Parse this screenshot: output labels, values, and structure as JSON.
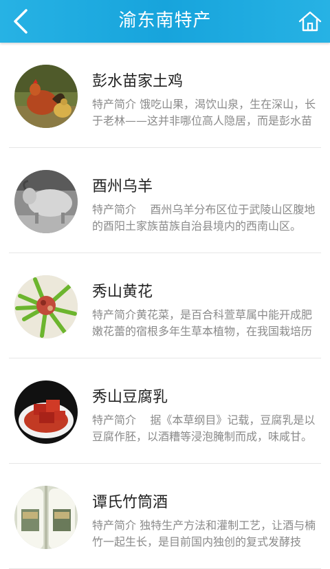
{
  "header": {
    "title": "渝东南特产",
    "back_icon": "chevron-left-icon",
    "home_icon": "home-icon"
  },
  "colors": {
    "header_bg": "#1aa7de",
    "title_text": "#222222",
    "desc_text": "#8a8a8a",
    "divider": "#e6e6e6"
  },
  "items": [
    {
      "title": "彭水苗家土鸡",
      "label": "特产简介",
      "desc": " 饿吃山果，渴饮山泉，生在深山，长于老林——这并非哪位高人隐居，而是彭水苗家土鸡的生长环境。",
      "image": "chicken-photo"
    },
    {
      "title": "酉州乌羊",
      "label": "特产简介",
      "desc": "    酉州乌羊分布区位于武陵山区腹地的酉阳土家族苗族自治县境内的西南山区。",
      "image": "goat-photo"
    },
    {
      "title": "秀山黄花",
      "label": "特产简介",
      "desc": "黄花菜，是百合科萱草属中能开成肥嫩花蕾的宿根多年生草本植物，在我国栽培历史悠久。",
      "image": "daylily-dish-photo"
    },
    {
      "title": "秀山豆腐乳",
      "label": "特产简介",
      "desc": "    据《本草纲目》记载，豆腐乳是以豆腐作胚，以酒糟等浸泡腌制而成，味咸甘。",
      "image": "fermented-tofu-photo"
    },
    {
      "title": "谭氏竹筒酒",
      "label": "特产简介",
      "desc": " 独特生产方法和灌制工艺，让酒与楠竹一起生长，是目前国内独创的复式发酵技术。",
      "image": "bamboo-wine-photo"
    }
  ]
}
